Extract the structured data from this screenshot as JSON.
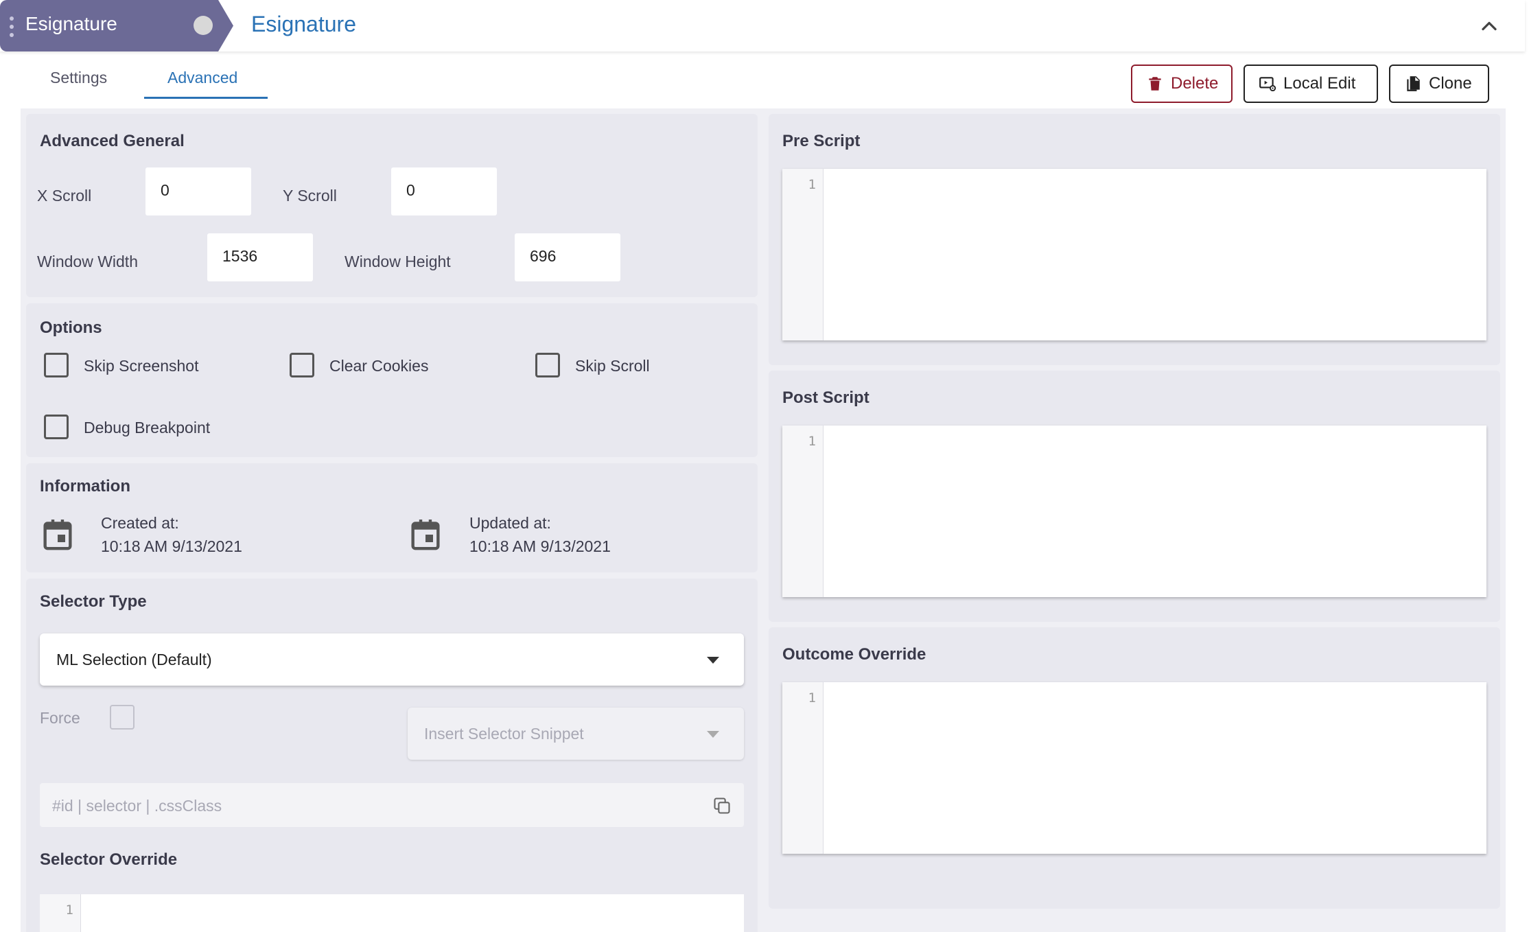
{
  "header": {
    "breadcrumb_label": "Esignature",
    "title": "Esignature"
  },
  "tabs": [
    {
      "label": "Settings"
    },
    {
      "label": "Advanced"
    }
  ],
  "actions": {
    "delete_label": "Delete",
    "local_edit_label": "Local Edit",
    "clone_label": "Clone"
  },
  "advanced_general": {
    "title": "Advanced General",
    "x_scroll": {
      "label": "X Scroll",
      "value": "0"
    },
    "y_scroll": {
      "label": "Y Scroll",
      "value": "0"
    },
    "window_width": {
      "label": "Window Width",
      "value": "1536"
    },
    "window_height": {
      "label": "Window Height",
      "value": "696"
    }
  },
  "options": {
    "title": "Options",
    "items": [
      {
        "label": "Skip Screenshot",
        "checked": false
      },
      {
        "label": "Clear Cookies",
        "checked": false
      },
      {
        "label": "Skip Scroll",
        "checked": false
      },
      {
        "label": "Debug Breakpoint",
        "checked": false
      }
    ]
  },
  "information": {
    "title": "Information",
    "created": {
      "label": "Created at:",
      "value": "10:18 AM 9/13/2021"
    },
    "updated": {
      "label": "Updated at:",
      "value": "10:18 AM 9/13/2021"
    }
  },
  "selector": {
    "title": "Selector Type",
    "type_value": "ML Selection (Default)",
    "force_label": "Force",
    "snippet_placeholder": "Insert Selector Snippet",
    "input_placeholder": "#id | selector | .cssClass",
    "override_title": "Selector Override",
    "override_line": "1"
  },
  "scripts": {
    "pre": {
      "title": "Pre Script",
      "line": "1"
    },
    "post": {
      "title": "Post Script",
      "line": "1"
    },
    "outcome": {
      "title": "Outcome Override",
      "line": "1"
    }
  },
  "colors": {
    "accent": "#2a72b5",
    "breadcrumb": "#6c6a96",
    "danger": "#8e1b2c"
  }
}
